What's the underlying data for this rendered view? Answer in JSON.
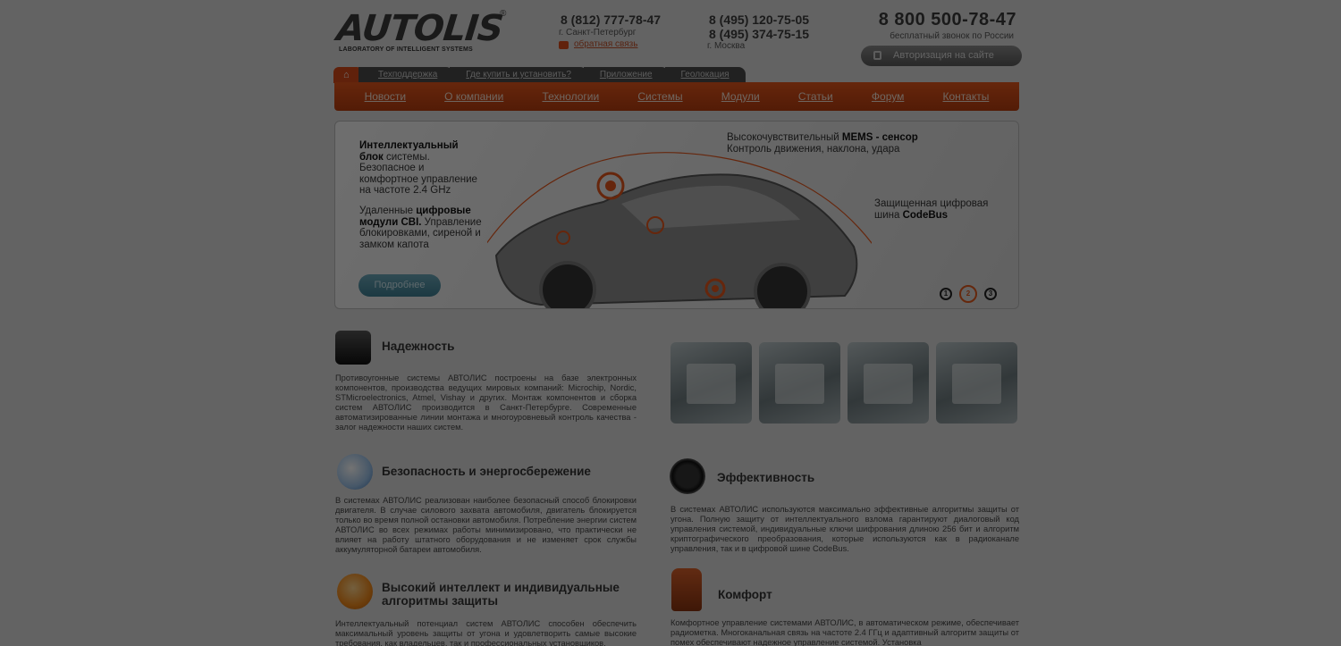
{
  "header": {
    "logo_text": "AUTOLIS",
    "logo_reg": "®",
    "logo_tagline": "LABORATORY OF INTELLIGENT SYSTEMS",
    "spb_phone": "8 (812) 777-78-47",
    "spb_city": "г. Санкт-Петербург",
    "feedback_link": "обратная связь",
    "msk_phone1": "8 (495) 120-75-05",
    "msk_phone2": "8 (495) 374-75-15",
    "msk_city": "г. Москва",
    "free_phone": "8 800 500-78-47",
    "free_note": "бесплатный звонок по России",
    "auth_button": "Авторизация на сайте"
  },
  "top_tabs": [
    "Техподдержка",
    "Где купить и установить?",
    "Приложение",
    "Геолокация"
  ],
  "menu": [
    "Новости",
    "О компании",
    "Технологии",
    "Системы",
    "Модули",
    "Статьи",
    "Форум",
    "Контакты"
  ],
  "banner": {
    "block1": "Интеллектуальный блок системы. Безопасное и комфортное управление на частоте 2.4 GHz",
    "block1_bold": "Интеллектуальный блок",
    "block1_rest": "системы. Безопасное и комфортное управление на частоте 2.4 GHz",
    "block2_pre": "Удаленные ",
    "block2_bold": "цифровые модули CBI.",
    "block2_rest": " Управление блокировками, сиреной и замком капота",
    "mems_pre": "Высокочувствительный ",
    "mems_bold": "MEMS - сенсор",
    "mems_line2": "Контроль движения, наклона, удара",
    "bus_line1": "Защищенная цифровая",
    "bus_pre": "шина ",
    "bus_bold": "CodeBus",
    "more_button": "Подробнее",
    "slides": [
      "1",
      "2",
      "3"
    ],
    "active_slide": 2
  },
  "features": {
    "reliability": {
      "title": "Надежность",
      "text": "Противоугонные системы АВТОЛИС построены на базе электронных компонентов, производства ведущих мировых компаний: Microchip, Nordic, STMicroelectronics, Atmel, Vishay и других. Монтаж компонентов и сборка систем АВТОЛИС производится в Санкт-Петербурге. Современные автоматизированные линии монтажа и многоуровневый контроль качества - залог надежности наших систем."
    },
    "safety": {
      "title": "Безопасность и энергосбережение",
      "text": "В системах АВТОЛИС реализован наиболее безопасный способ блокировки двигателя. В случае силового захвата автомобиля, двигатель блокируется только во время полной остановки автомобиля. Потребление энергии систем АВТОЛИС во всех режимах работы минимизировано, что практически не влияет на работу штатного оборудования и не изменяет срок службы аккумуляторной батареи автомобиля."
    },
    "intellect": {
      "title": "Высокий интеллект и индивидуальные алгоритмы защиты",
      "text": "Интеллектуальный потенциал систем АВТОЛИС способен обеспечить максимальный уровень защиты от угона и удовлетворить самые высокие требования, как владельцев, так и профессиональных установщиков."
    },
    "efficiency": {
      "title": "Эффективность",
      "text": "В системах АВТОЛИС используются максимально эффективные алгоритмы защиты от угона. Полную защиту от интеллектуального взлома гарантируют диалоговый код управления системой, индивидуальные ключи шифрования длиною 256 бит и алгоритм криптографического преобразования, которые используются как в радиоканале управления, так и в цифровой шине CodeBus."
    },
    "comfort": {
      "title": "Комфорт",
      "text": "Комфортное управление системами АВТОЛИС, в автоматическом режиме, обеспечивает радиометка. Многоканальная связь на частоте 2.4 ГГц и адаптивный алгоритм защиты от помех обеспечивают надежное управление системой. Установка"
    }
  },
  "colors": {
    "accent": "#e2561c",
    "overlay": "rgba(0,0,0,0.55)"
  }
}
